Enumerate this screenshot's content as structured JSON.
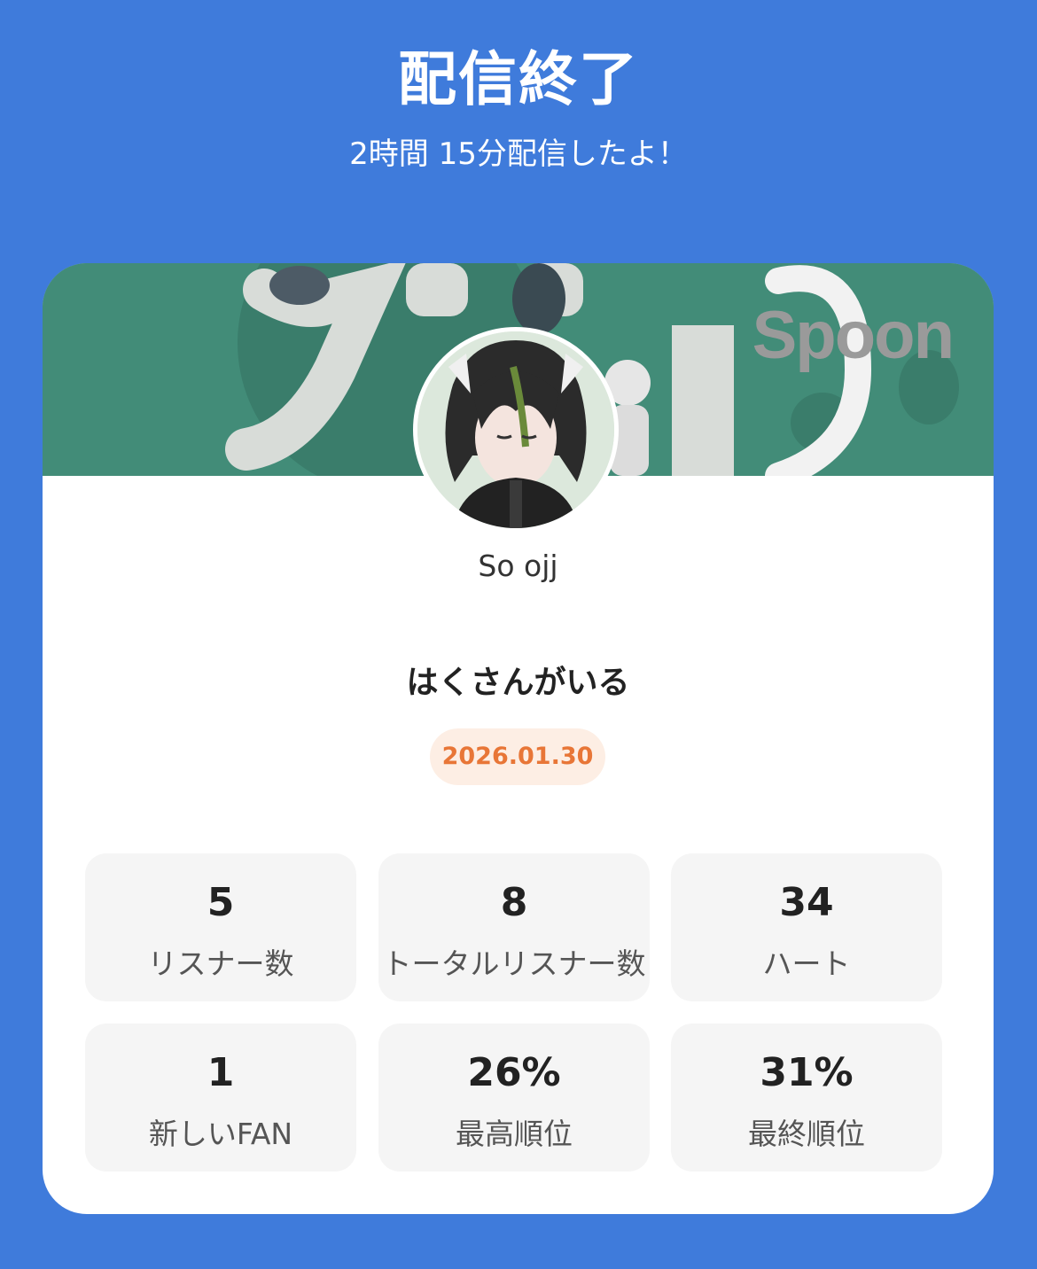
{
  "header": {
    "title": "配信終了",
    "subtitle": "2時間 15分配信したよ！"
  },
  "card": {
    "banner": {
      "brand": "Spoon",
      "background_color": "#428c78"
    },
    "username": "So ojj",
    "room_title": "はくさんがいる",
    "date": "2026.01.30",
    "stats": [
      {
        "value": "5",
        "label": "リスナー数"
      },
      {
        "value": "8",
        "label": "トータルリスナー数"
      },
      {
        "value": "34",
        "label": "ハート"
      },
      {
        "value": "1",
        "label": "新しいFAN"
      },
      {
        "value": "26%",
        "label": "最高順位"
      },
      {
        "value": "31%",
        "label": "最終順位"
      }
    ]
  },
  "colors": {
    "background": "#3f7bdb",
    "accent": "#e87637",
    "card": "#ffffff",
    "stat_tile": "#f5f5f5"
  }
}
